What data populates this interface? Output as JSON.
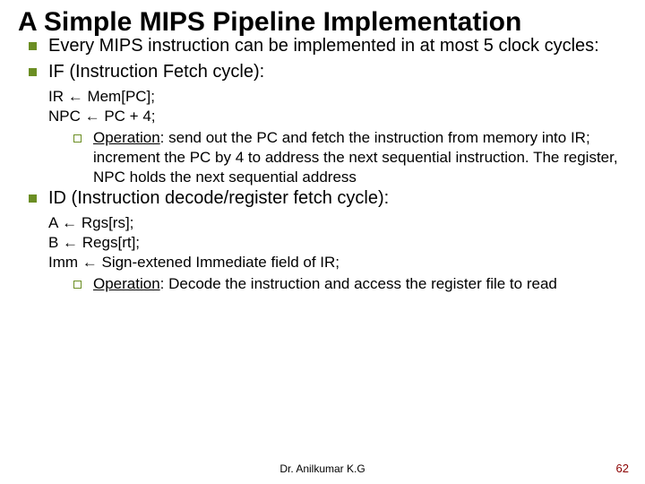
{
  "title": "A Simple MIPS Pipeline Implementation",
  "bullets": {
    "b1": "Every MIPS instruction can be implemented in at most 5 clock cycles:",
    "b2": "IF (Instruction Fetch  cycle):",
    "b3": "ID (Instruction decode/register fetch cycle):"
  },
  "if_block": {
    "l1": "IR ← Mem[PC];",
    "l2": "NPC ← PC + 4;",
    "op_label": "Operation",
    "op_text": ": send out the PC and fetch the instruction from memory into IR; increment the PC by 4 to address the next sequential instruction. The register, NPC holds the next sequential address"
  },
  "id_block": {
    "l1": "A ← Rgs[rs];",
    "l2": "B ← Regs[rt];",
    "l3": "Imm ← Sign-extened Immediate field of IR;",
    "op_label": "Operation",
    "op_text": ": Decode the instruction and access the register file to read"
  },
  "footer": "Dr. Anilkumar K.G",
  "page": "62"
}
